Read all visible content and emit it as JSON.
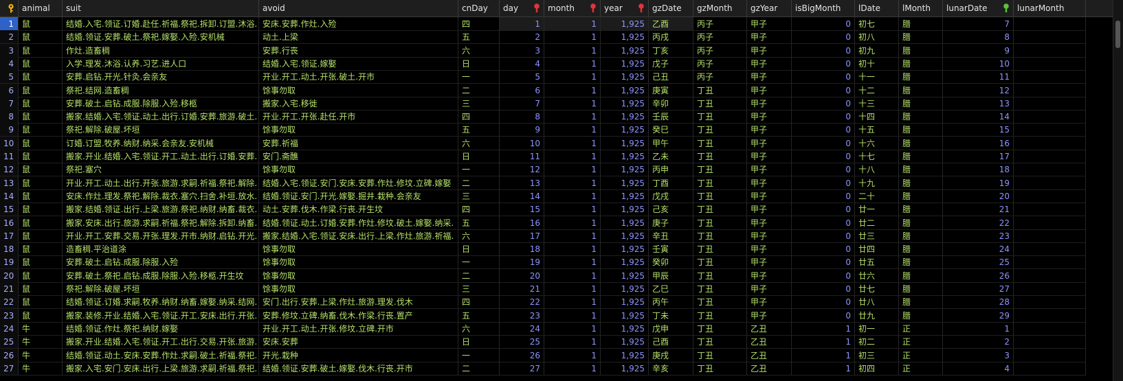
{
  "columns": [
    {
      "key": "rn",
      "label": "",
      "w": 27,
      "icon": "key"
    },
    {
      "key": "animal",
      "label": "animal",
      "w": 64
    },
    {
      "key": "suit",
      "label": "suit",
      "w": 286
    },
    {
      "key": "avoid",
      "label": "avoid",
      "w": 290
    },
    {
      "key": "cnDay",
      "label": "cnDay",
      "w": 60
    },
    {
      "key": "day",
      "label": "day",
      "w": 65,
      "filter": "red"
    },
    {
      "key": "month",
      "label": "month",
      "w": 82,
      "filter": "red"
    },
    {
      "key": "year",
      "label": "year",
      "w": 70,
      "filter": "red"
    },
    {
      "key": "gzDate",
      "label": "gzDate",
      "w": 65
    },
    {
      "key": "gzMonth",
      "label": "gzMonth",
      "w": 78
    },
    {
      "key": "gzYear",
      "label": "gzYear",
      "w": 65
    },
    {
      "key": "isBigMonth",
      "label": "isBigMonth",
      "w": 92
    },
    {
      "key": "lDate",
      "label": "lDate",
      "w": 64
    },
    {
      "key": "lMonth",
      "label": "lMonth",
      "w": 64
    },
    {
      "key": "lunarDate",
      "label": "lunarDate",
      "w": 103,
      "filter": "green"
    },
    {
      "key": "lunarMonth",
      "label": "lunarMonth",
      "w": 105
    }
  ],
  "colors": {
    "text": "#b5e06a",
    "number": "#8e95ff",
    "header": "#e6e6e6",
    "selected": "#2f62c9",
    "key": "#f3b400",
    "filter_red": "#e0343a",
    "filter_green": "#5cc23a"
  },
  "rows": [
    [
      "1",
      "鼠",
      "结婚.入宅.领证.订婚.赴任.祈福.祭祀.拆卸.订盟.沐浴.",
      "安床.安葬.作灶.入殓",
      "四",
      "1",
      "1",
      "1,925",
      "乙酉",
      "丙子",
      "甲子",
      "0",
      "初七",
      "腊",
      "7",
      ""
    ],
    [
      "2",
      "鼠",
      "结婚.领证.安葬.破土.祭祀.嫁娶.入殓.安机械",
      "动土.上梁",
      "五",
      "2",
      "1",
      "1,925",
      "丙戌",
      "丙子",
      "甲子",
      "0",
      "初八",
      "腊",
      "8",
      ""
    ],
    [
      "3",
      "鼠",
      "作灶.造畜稠",
      "安葬.行丧",
      "六",
      "3",
      "1",
      "1,925",
      "丁亥",
      "丙子",
      "甲子",
      "0",
      "初九",
      "腊",
      "9",
      ""
    ],
    [
      "4",
      "鼠",
      "入学.理发.沐浴.认养.习艺.进人口",
      "结婚.入宅.领证.嫁娶",
      "日",
      "4",
      "1",
      "1,925",
      "戊子",
      "丙子",
      "甲子",
      "0",
      "初十",
      "腊",
      "10",
      ""
    ],
    [
      "5",
      "鼠",
      "安葬.启钻.开光.针灸.会亲友",
      "开业.开工.动土.开张.破土.开市",
      "一",
      "5",
      "1",
      "1,925",
      "己丑",
      "丙子",
      "甲子",
      "0",
      "十一",
      "腊",
      "11",
      ""
    ],
    [
      "6",
      "鼠",
      "祭祀.结网.造畜稠",
      "馀事勿取",
      "二",
      "6",
      "1",
      "1,925",
      "庚寅",
      "丁丑",
      "甲子",
      "0",
      "十二",
      "腊",
      "12",
      ""
    ],
    [
      "7",
      "鼠",
      "安葬.破土.启钻.成服.除服.入殓.移柩",
      "搬家.入宅.移徙",
      "三",
      "7",
      "1",
      "1,925",
      "辛卯",
      "丁丑",
      "甲子",
      "0",
      "十三",
      "腊",
      "13",
      ""
    ],
    [
      "8",
      "鼠",
      "搬家.结婚.入宅.领证.动土.出行.订婚.安葬.旅游.破土.",
      "开业.开工.开张.赴任.开市",
      "四",
      "8",
      "1",
      "1,925",
      "壬辰",
      "丁丑",
      "甲子",
      "0",
      "十四",
      "腊",
      "14",
      ""
    ],
    [
      "9",
      "鼠",
      "祭祀.解除.破屋.坏垣",
      "馀事勿取",
      "五",
      "9",
      "1",
      "1,925",
      "癸巳",
      "丁丑",
      "甲子",
      "0",
      "十五",
      "腊",
      "15",
      ""
    ],
    [
      "10",
      "鼠",
      "订婚.订盟.牧养.纳财.纳采.会亲友.安机械",
      "安葬.祈福",
      "六",
      "10",
      "1",
      "1,925",
      "甲午",
      "丁丑",
      "甲子",
      "0",
      "十六",
      "腊",
      "16",
      ""
    ],
    [
      "11",
      "鼠",
      "搬家.开业.结婚.入宅.领证.开工.动土.出行.订婚.安葬.",
      "安门.斋醮",
      "日",
      "11",
      "1",
      "1,925",
      "乙未",
      "丁丑",
      "甲子",
      "0",
      "十七",
      "腊",
      "17",
      ""
    ],
    [
      "12",
      "鼠",
      "祭祀.塞穴",
      "馀事勿取",
      "一",
      "12",
      "1",
      "1,925",
      "丙申",
      "丁丑",
      "甲子",
      "0",
      "十八",
      "腊",
      "18",
      ""
    ],
    [
      "13",
      "鼠",
      "开业.开工.动土.出行.开张.旅游.求嗣.祈福.祭祀.解除.",
      "结婚.入宅.领证.安门.安床.安葬.作灶.修坟.立碑.嫁娶",
      "二",
      "13",
      "1",
      "1,925",
      "丁酉",
      "丁丑",
      "甲子",
      "0",
      "十九",
      "腊",
      "19",
      ""
    ],
    [
      "14",
      "鼠",
      "安床.作灶.理发.祭祀.解除.裁衣.塞穴.扫舍.补垣.放水.",
      "结婚.领证.安门.开光.嫁娶.掘井.栽种.会亲友",
      "三",
      "14",
      "1",
      "1,925",
      "戊戌",
      "丁丑",
      "甲子",
      "0",
      "二十",
      "腊",
      "20",
      ""
    ],
    [
      "15",
      "鼠",
      "搬家.结婚.领证.出行.上梁.旅游.祭祀.纳财.纳畜.裁衣.",
      "动土.安葬.伐木.作梁.行丧.开生坟",
      "四",
      "15",
      "1",
      "1,925",
      "己亥",
      "丁丑",
      "甲子",
      "0",
      "廿一",
      "腊",
      "21",
      ""
    ],
    [
      "16",
      "鼠",
      "搬家.安床.出行.旅游.求嗣.祈福.祭祀.解除.拆卸.纳畜.",
      "结婚.领证.动土.订婚.安葬.作灶.修坟.破土.嫁娶.纳采.",
      "五",
      "16",
      "1",
      "1,925",
      "庚子",
      "丁丑",
      "甲子",
      "0",
      "廿二",
      "腊",
      "22",
      ""
    ],
    [
      "17",
      "鼠",
      "开业.开工.安葬.交易.开张.理发.开市.纳财.启钻.开光.",
      "搬家.结婚.入宅.领证.安床.出行.上梁.作灶.旅游.祈福.",
      "六",
      "17",
      "1",
      "1,925",
      "辛丑",
      "丁丑",
      "甲子",
      "0",
      "廿三",
      "腊",
      "23",
      ""
    ],
    [
      "18",
      "鼠",
      "造畜稠.平治道涂",
      "馀事勿取",
      "日",
      "18",
      "1",
      "1,925",
      "壬寅",
      "丁丑",
      "甲子",
      "0",
      "廿四",
      "腊",
      "24",
      ""
    ],
    [
      "19",
      "鼠",
      "安葬.破土.启钻.成服.除服.入殓",
      "馀事勿取",
      "一",
      "19",
      "1",
      "1,925",
      "癸卯",
      "丁丑",
      "甲子",
      "0",
      "廿五",
      "腊",
      "25",
      ""
    ],
    [
      "20",
      "鼠",
      "安葬.破土.祭祀.启钻.成服.除服.入殓.移柩.开生坟",
      "馀事勿取",
      "二",
      "20",
      "1",
      "1,925",
      "甲辰",
      "丁丑",
      "甲子",
      "0",
      "廿六",
      "腊",
      "26",
      ""
    ],
    [
      "21",
      "鼠",
      "祭祀.解除.破屋.坏垣",
      "馀事勿取",
      "三",
      "21",
      "1",
      "1,925",
      "乙巳",
      "丁丑",
      "甲子",
      "0",
      "廿七",
      "腊",
      "27",
      ""
    ],
    [
      "22",
      "鼠",
      "结婚.领证.订婚.求嗣.牧养.纳财.纳畜.嫁娶.纳采.结网.",
      "安门.出行.安葬.上梁.作灶.旅游.理发.伐木",
      "四",
      "22",
      "1",
      "1,925",
      "丙午",
      "丁丑",
      "甲子",
      "0",
      "廿八",
      "腊",
      "28",
      ""
    ],
    [
      "23",
      "鼠",
      "搬家.装修.开业.结婚.入宅.领证.开工.安床.出行.开张.",
      "安葬.修坟.立碑.纳畜.伐木.作梁.行丧.置产",
      "五",
      "23",
      "1",
      "1,925",
      "丁未",
      "丁丑",
      "甲子",
      "0",
      "廿九",
      "腊",
      "29",
      ""
    ],
    [
      "24",
      "牛",
      "结婚.领证.作灶.祭祀.纳财.嫁娶",
      "开业.开工.动土.开张.修坟.立碑.开市",
      "六",
      "24",
      "1",
      "1,925",
      "戊申",
      "丁丑",
      "乙丑",
      "1",
      "初一",
      "正",
      "1",
      ""
    ],
    [
      "25",
      "牛",
      "搬家.开业.结婚.入宅.领证.开工.出行.交易.开张.旅游.",
      "安床.安葬",
      "日",
      "25",
      "1",
      "1,925",
      "己酉",
      "丁丑",
      "乙丑",
      "1",
      "初二",
      "正",
      "2",
      ""
    ],
    [
      "26",
      "牛",
      "结婚.领证.动土.安床.安葬.作灶.求嗣.破土.祈福.祭祀.",
      "开光.栽种",
      "一",
      "26",
      "1",
      "1,925",
      "庚戌",
      "丁丑",
      "乙丑",
      "1",
      "初三",
      "正",
      "3",
      ""
    ],
    [
      "27",
      "牛",
      "搬家.入宅.安门.安床.出行.上梁.旅游.求嗣.祈福.祭祀.",
      "结婚.领证.安葬.破土.嫁娶.伐木.行丧.开市",
      "二",
      "27",
      "1",
      "1,925",
      "辛亥",
      "丁丑",
      "乙丑",
      "1",
      "初四",
      "正",
      "4",
      ""
    ]
  ]
}
